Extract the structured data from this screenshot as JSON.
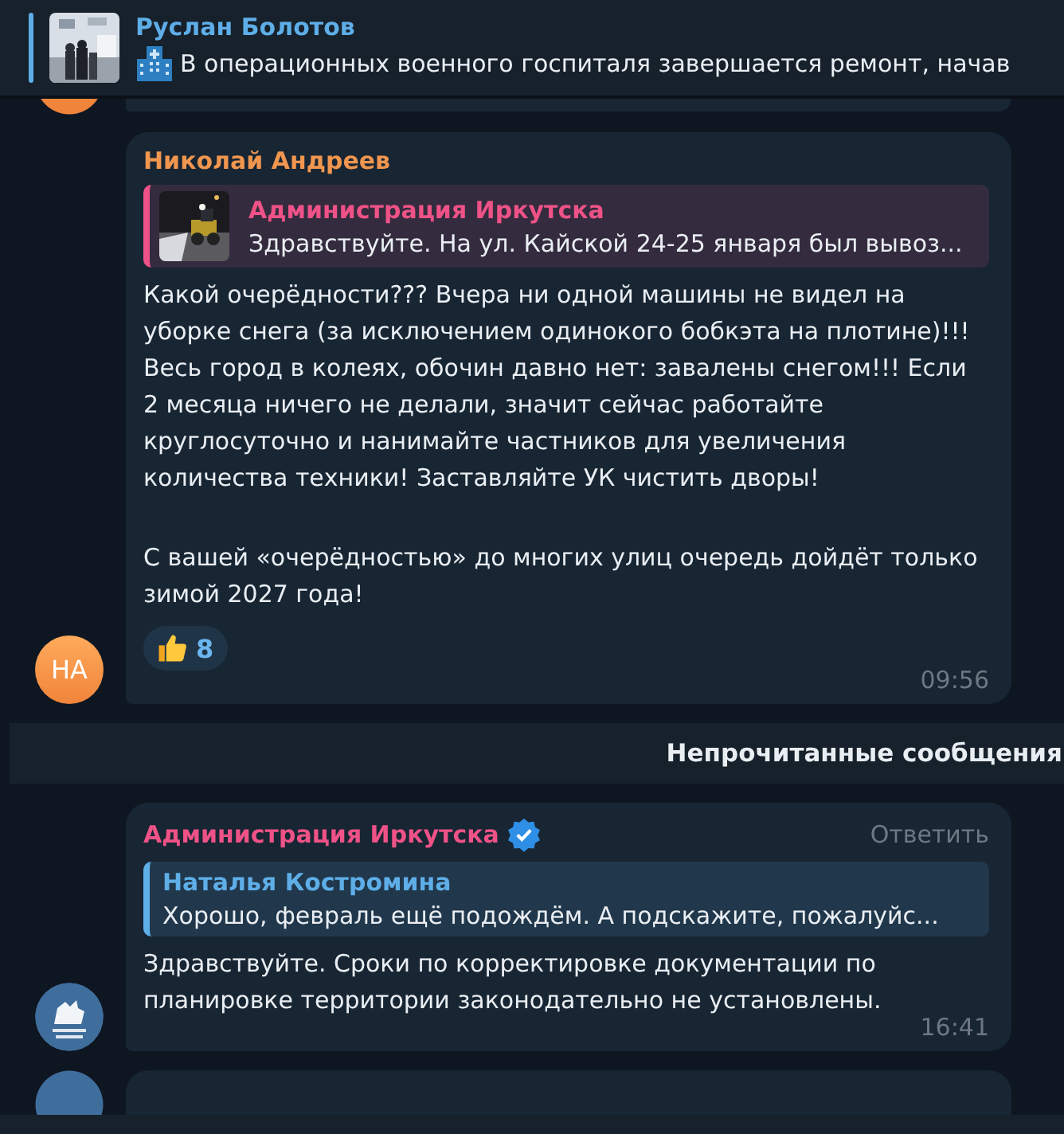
{
  "pinned": {
    "author": "Руслан Болотов",
    "text": "В операционных военного госпиталя завершается ремонт, начав"
  },
  "messages": [
    {
      "author": "Николай Андреев",
      "color": "#f0964f",
      "avatar": {
        "kind": "initials",
        "text": "НА"
      },
      "reply": {
        "author": "Администрация Иркутска",
        "text": "Здравствуйте. На ул. Кайской 24-25 января был вывоз...",
        "color": "#ee5287"
      },
      "text": [
        "Какой очерёдности??? Вчера ни одной машины не видел на уборке снега (за исключением одинокого бобкэта на плотине)!!! Весь город в колеях, обочин давно нет: завалены снегом!!! Если 2 месяца ничего не делали, значит сейчас работайте круглосуточно и нанимайте частников для увеличения количества техники! Заставляйте УК чистить дворы!",
        "С вашей «очерёдностью» до многих улиц очередь дойдёт только зимой 2027 года!"
      ],
      "reactions": [
        {
          "count": "8",
          "selected": false
        }
      ],
      "time": "09:56",
      "verified": false
    },
    {
      "author": "Администрация Иркутска",
      "color": "#ee5287",
      "avatar": {
        "kind": "logo"
      },
      "action": "Ответить",
      "reply": {
        "author": "Наталья Костромина",
        "text": "Хорошо,  февраль ещё подождём.  А подскажите, пожалуйс...",
        "color": "#5eaee8"
      },
      "text": [
        "Здравствуйте. Сроки по корректировке документации по планировке территории законодательно не установлены."
      ],
      "time": "16:41",
      "verified": true
    }
  ],
  "separator": "Непрочитанные сообщения"
}
